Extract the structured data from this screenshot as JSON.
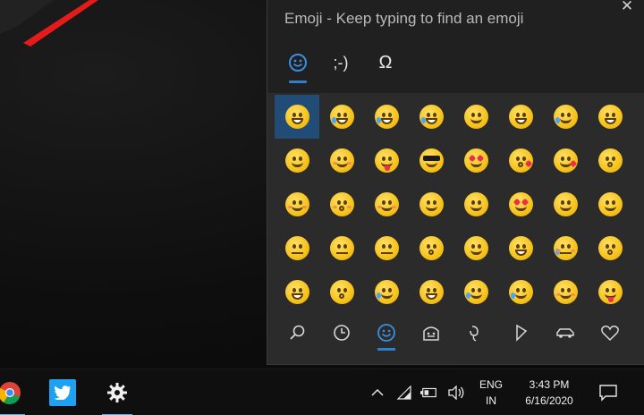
{
  "emoji_panel": {
    "title": "Emoji - Keep typing to find an emoji",
    "tabs": [
      {
        "label": "emoji",
        "icon": "smiley-icon",
        "active": true
      },
      {
        "label": ";-)",
        "icon": "kaomoji-icon",
        "active": false
      },
      {
        "label": "Ω",
        "icon": "omega-icon",
        "active": false
      }
    ],
    "selected_index": 0,
    "emojis": [
      "grinning",
      "grin-sweat",
      "joy",
      "rofl",
      "smiley",
      "grinning-eyes",
      "sweat-smile",
      "laughing",
      "wink",
      "blush",
      "yum",
      "sunglasses",
      "heart-eyes",
      "kissing-heart",
      "heart-kiss",
      "kissing",
      "relieved",
      "kissing-smile",
      "smiling",
      "slight-smile",
      "hugging",
      "star-struck",
      "thinking",
      "raised-eyebrow",
      "neutral",
      "expressionless",
      "no-mouth",
      "rolling-eyes",
      "smirk",
      "persevere",
      "disappointed-relieved",
      "open-mouth",
      "zipper",
      "hushed",
      "sleepy",
      "tired",
      "sleeping-face",
      "drooling",
      "relieved-2",
      "tongue"
    ],
    "categories": [
      {
        "name": "search",
        "icon": "search-icon",
        "active": false
      },
      {
        "name": "recent",
        "icon": "clock-icon",
        "active": false
      },
      {
        "name": "smileys",
        "icon": "smiley-icon",
        "active": true
      },
      {
        "name": "people",
        "icon": "people-icon",
        "active": false
      },
      {
        "name": "celebration",
        "icon": "balloon-icon",
        "active": false
      },
      {
        "name": "food",
        "icon": "pizza-icon",
        "active": false
      },
      {
        "name": "travel",
        "icon": "car-icon",
        "active": false
      },
      {
        "name": "symbols",
        "icon": "heart-icon",
        "active": false
      }
    ]
  },
  "taskbar": {
    "apps": [
      {
        "name": "Chrome",
        "icon": "chrome-icon"
      },
      {
        "name": "Twitter",
        "icon": "twitter-icon"
      },
      {
        "name": "Settings",
        "icon": "gear-icon"
      }
    ],
    "tray_icons": [
      "chevron-up-icon",
      "wifi-icon",
      "battery-icon",
      "volume-icon"
    ],
    "language": {
      "line1": "ENG",
      "line2": "IN"
    },
    "clock": {
      "time": "3:43 PM",
      "date": "6/16/2020"
    },
    "accent_color": "#2f7fd0"
  }
}
